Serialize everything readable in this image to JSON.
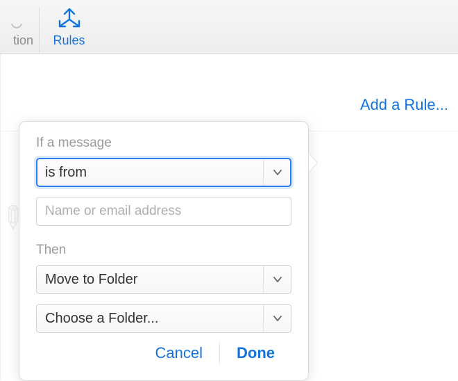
{
  "toolbar": {
    "left_truncated_label": "tion",
    "rules_label": "Rules"
  },
  "content": {
    "add_rule_label": "Add a Rule..."
  },
  "popover": {
    "condition_label": "If a message",
    "condition_dropdown": {
      "selected": "is from"
    },
    "value_input": {
      "value": "",
      "placeholder": "Name or email address"
    },
    "action_label": "Then",
    "action_dropdown": {
      "selected": "Move to Folder"
    },
    "target_dropdown": {
      "selected": "Choose a Folder..."
    },
    "buttons": {
      "cancel": "Cancel",
      "done": "Done"
    }
  },
  "colors": {
    "accent": "#1273de",
    "focus_ring": "#2d7ee8",
    "label_muted": "#9a9a9a",
    "border": "#cfcfcf"
  }
}
